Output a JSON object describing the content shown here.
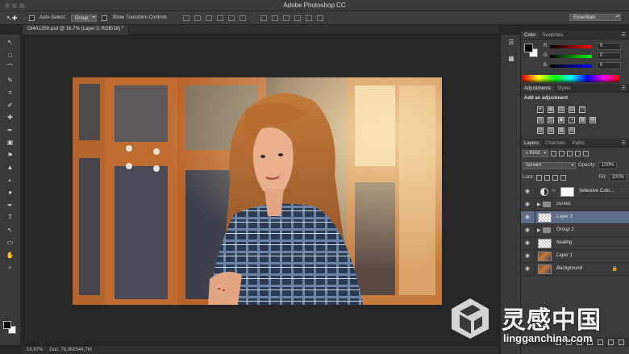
{
  "app": {
    "title": "Adobe Photoshop CC"
  },
  "options_bar": {
    "tool_glyph": "↖✚",
    "auto_select_label": "Auto-Select:",
    "auto_select_value": "Group",
    "transform_label": "Show Transform Controls",
    "workspace": "Essentials"
  },
  "document": {
    "tab_title": "GI4A1359.psd @ 16,7% (Layer 3, RGB/16) *"
  },
  "status": {
    "zoom": "16,67%",
    "doc_size": "Doc: 76,9M/544,7M"
  },
  "tools": [
    "↖",
    "□",
    "⌒",
    "✎",
    "⌗",
    "✐",
    "✚",
    "✒",
    "▣",
    "⚑",
    "▲",
    "◐",
    "●",
    "✒",
    "T",
    "↖",
    "▭",
    "✋",
    "⌕"
  ],
  "color_panel": {
    "tabs": [
      "Color",
      "Swatches"
    ],
    "channels": [
      {
        "label": "R",
        "value": "0"
      },
      {
        "label": "G",
        "value": "0"
      },
      {
        "label": "B",
        "value": "0"
      }
    ]
  },
  "adjustments_panel": {
    "tabs": [
      "Adjustments",
      "Styles"
    ],
    "title": "Add an adjustment",
    "rows": [
      [
        "☀",
        "▦",
        "▧",
        "▨",
        "▽"
      ],
      [
        "▤",
        "▥",
        "▣",
        "◑",
        "▩",
        "▦"
      ],
      [
        "▧",
        "▨",
        "▩",
        "▤"
      ]
    ]
  },
  "layers_panel": {
    "tabs": [
      "Layers",
      "Channels",
      "Paths"
    ],
    "filter_label": "⌕ Kind",
    "blend_mode": "Screen",
    "opacity_label": "Opacity:",
    "opacity_value": "100%",
    "lock_label": "Lock:",
    "fill_label": "Fill:",
    "fill_value": "100%",
    "layers": [
      {
        "name": "Selective Colo...",
        "kind": "adjustment",
        "selected": false
      },
      {
        "name": "curves",
        "kind": "group",
        "selected": false
      },
      {
        "name": "Layer 3",
        "kind": "transparent",
        "selected": true
      },
      {
        "name": "Group 1",
        "kind": "group",
        "selected": false
      },
      {
        "name": "healing",
        "kind": "transparent",
        "selected": false
      },
      {
        "name": "Layer 1",
        "kind": "photo",
        "selected": false
      },
      {
        "name": "Background",
        "kind": "photo-locked",
        "selected": false
      }
    ]
  },
  "watermark": {
    "cn": "灵感中国",
    "url": "lingganchina.com"
  },
  "colors": {
    "selected_layer": "#5d6d85",
    "panel_bg": "#3b3b3b",
    "canvas_bg": "#262626"
  }
}
